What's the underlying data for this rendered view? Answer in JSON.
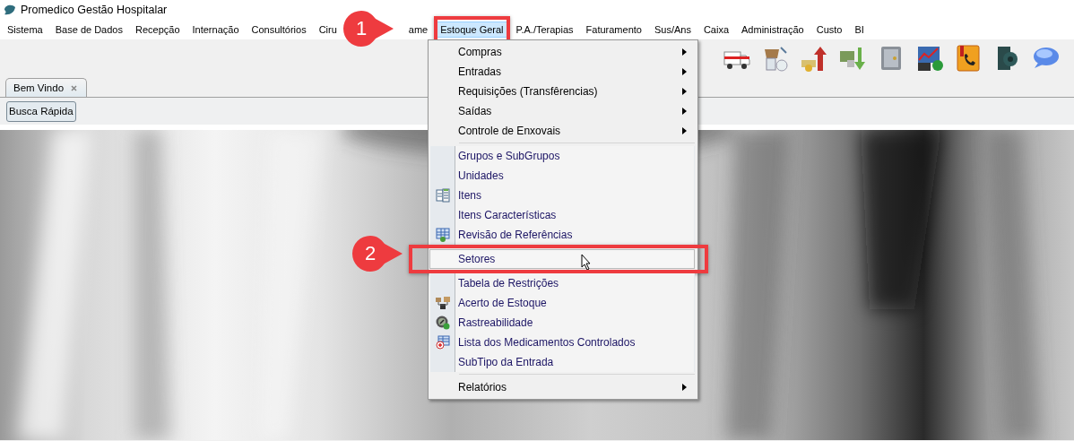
{
  "window": {
    "title": "Promedico Gestão Hospitalar"
  },
  "menu_bar": [
    {
      "label": "Sistema",
      "selected": false
    },
    {
      "label": "Base de Dados",
      "selected": false
    },
    {
      "label": "Recepção",
      "selected": false
    },
    {
      "label": "Internação",
      "selected": false
    },
    {
      "label": "Consultórios",
      "selected": false
    },
    {
      "label": "Ciru",
      "selected": false,
      "covered": true
    },
    {
      "label": "ame",
      "selected": false
    },
    {
      "label": "Estoque Geral",
      "selected": true
    },
    {
      "label": "P.A./Terapias",
      "selected": false
    },
    {
      "label": "Faturamento",
      "selected": false
    },
    {
      "label": "Sus/Ans",
      "selected": false
    },
    {
      "label": "Caixa",
      "selected": false
    },
    {
      "label": "Administração",
      "selected": false
    },
    {
      "label": "Custo",
      "selected": false
    },
    {
      "label": "BI",
      "selected": false
    }
  ],
  "tabs": [
    {
      "label": "Bem Vindo",
      "selected": true
    }
  ],
  "quick_search_button": "Busca Rápida",
  "dropdown": {
    "items": [
      {
        "kind": "submenu",
        "label": "Compras",
        "selected": false
      },
      {
        "kind": "submenu",
        "label": "Entradas",
        "selected": false
      },
      {
        "kind": "submenu",
        "label": "Requisições (Transfêrencias)",
        "selected": false
      },
      {
        "kind": "submenu",
        "label": "Saídas",
        "selected": false
      },
      {
        "kind": "submenu",
        "label": "Controle de Enxovais",
        "selected": false
      },
      {
        "kind": "separator"
      },
      {
        "kind": "action",
        "label": "Grupos e SubGrupos",
        "selected": false
      },
      {
        "kind": "action",
        "label": "Unidades",
        "selected": false
      },
      {
        "kind": "action",
        "label": "Itens",
        "selected": false
      },
      {
        "kind": "action",
        "label": "Itens Características",
        "selected": false
      },
      {
        "kind": "action",
        "label": "Revisão de Referências",
        "selected": false
      },
      {
        "kind": "action",
        "label": "Setores",
        "selected": true
      },
      {
        "kind": "action",
        "label": "Tabela de Restrições",
        "selected": false
      },
      {
        "kind": "action",
        "label": "Acerto de Estoque",
        "selected": false
      },
      {
        "kind": "action",
        "label": "Rastreabilidade",
        "selected": false
      },
      {
        "kind": "action",
        "label": "Lista dos Medicamentos Controlados",
        "selected": false
      },
      {
        "kind": "action",
        "label": "SubTipo da Entrada",
        "selected": false
      },
      {
        "kind": "separator"
      },
      {
        "kind": "submenu",
        "label": "Relatórios",
        "selected": false
      }
    ]
  },
  "annotations": [
    {
      "label": "1"
    },
    {
      "label": "2"
    }
  ]
}
